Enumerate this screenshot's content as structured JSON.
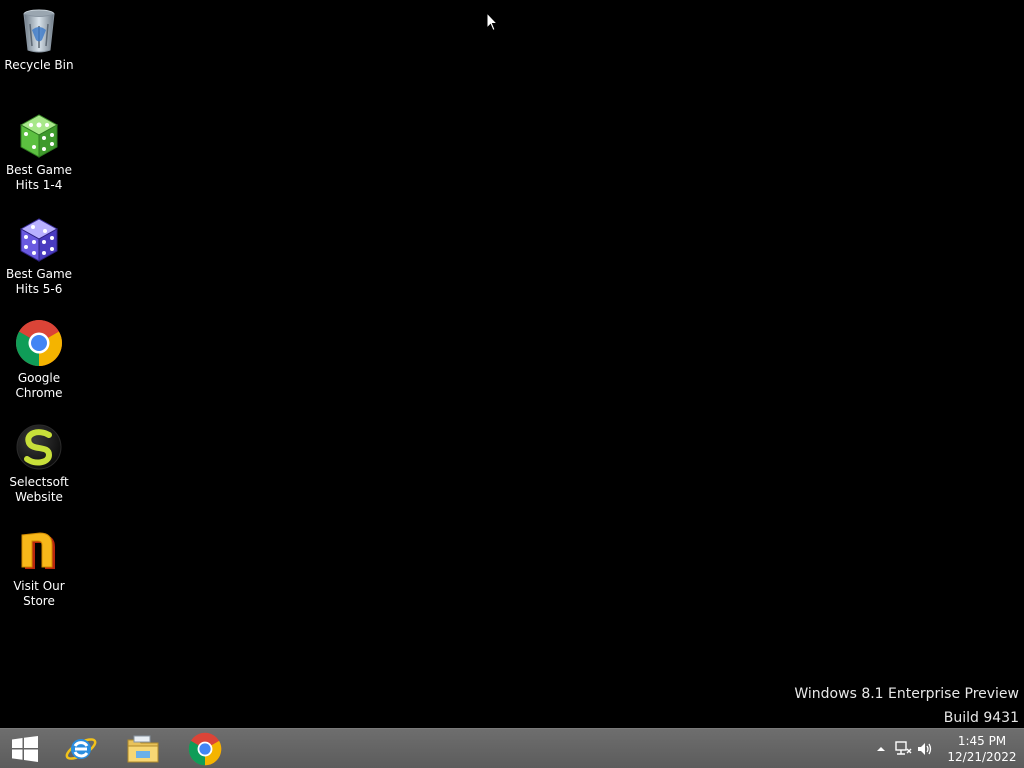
{
  "desktop": {
    "icons": [
      {
        "label": "Recycle Bin",
        "icon": "recycle-bin-icon"
      },
      {
        "label": "Best Game\nHits 1-4",
        "icon": "green-dice-icon"
      },
      {
        "label": "Best Game\nHits 5-6",
        "icon": "purple-dice-icon"
      },
      {
        "label": "Google\nChrome",
        "icon": "chrome-icon"
      },
      {
        "label": "Selectsoft\nWebsite",
        "icon": "selectsoft-icon"
      },
      {
        "label": "Visit Our\nStore",
        "icon": "store-icon"
      }
    ],
    "watermark": {
      "line1": "Windows 8.1 Enterprise Preview",
      "line2": "Build 9431"
    }
  },
  "taskbar": {
    "pinned": [
      {
        "icon": "start-icon"
      },
      {
        "icon": "internet-explorer-icon"
      },
      {
        "icon": "file-explorer-icon"
      },
      {
        "icon": "chrome-icon"
      }
    ],
    "tray": {
      "icons": [
        "show-hidden-icon",
        "network-icon",
        "volume-icon"
      ],
      "time": "1:45 PM",
      "date": "12/21/2022"
    }
  }
}
